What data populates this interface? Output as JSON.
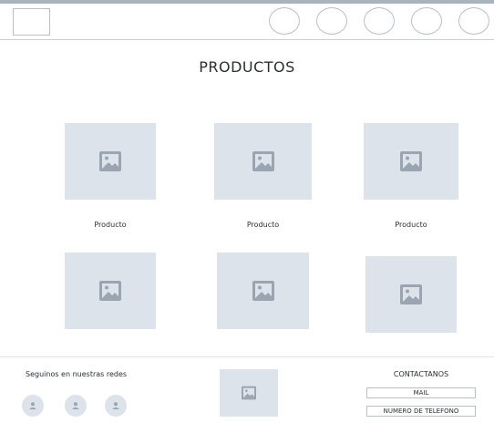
{
  "page": {
    "title": "PRODUCTOS"
  },
  "products": [
    {
      "label": "Producto",
      "icon": "image-icon"
    },
    {
      "label": "Producto",
      "icon": "image-icon"
    },
    {
      "label": "Producto",
      "icon": "image-icon"
    },
    {
      "label": "",
      "icon": "image-icon"
    },
    {
      "label": "",
      "icon": "image-icon"
    },
    {
      "label": "",
      "icon": "image-icon"
    }
  ],
  "footer": {
    "social_title": "Seguinos en nuestras redes",
    "contact_title": "CONTACTANOS",
    "mail_label": "MAIL",
    "phone_label": "NUMERO DE TELEFONO"
  },
  "colors": {
    "placeholder_bg": "#dde3ea",
    "icon": "#9aa5b1",
    "border": "#b8c0c8"
  }
}
